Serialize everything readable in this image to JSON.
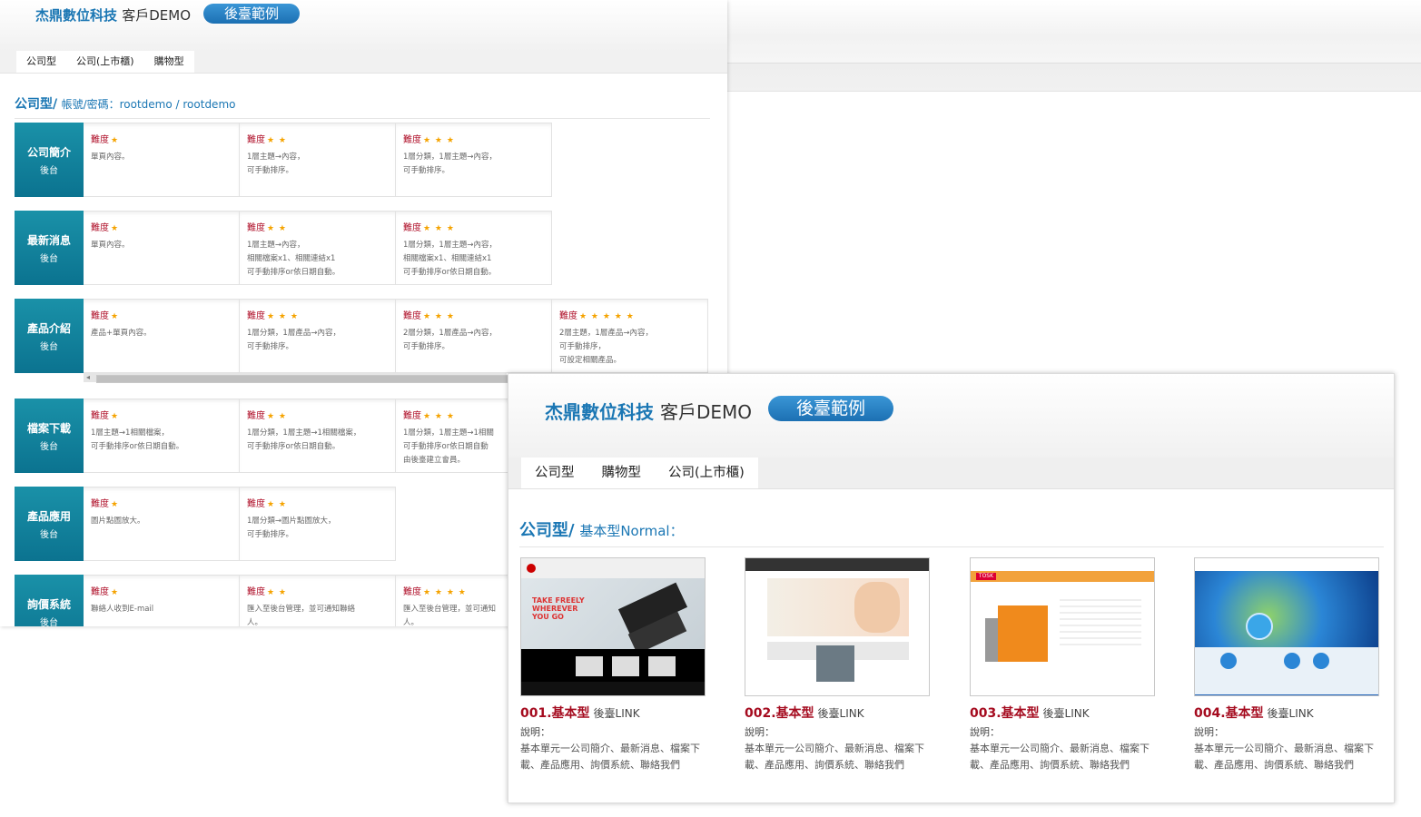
{
  "window1": {
    "brand": "杰鼎數位科技",
    "brand_suffix": "客戶DEMO",
    "badge": "後臺範例",
    "tabs": [
      "公司型",
      "公司(上市櫃)",
      "購物型"
    ],
    "section_title": "公司型/",
    "section_subtitle": "帳號/密碼：rootdemo / rootdemo",
    "difficulty_label": "難度",
    "rows": [
      {
        "name": "公司簡介",
        "sub": "後台",
        "cells": [
          {
            "stars": "★",
            "desc": "單頁內容。"
          },
          {
            "stars": "★ ★",
            "desc": "1層主題→內容，\n可手動排序。"
          },
          {
            "stars": "★ ★ ★",
            "desc": "1層分類，1層主題→內容，\n可手動排序。"
          }
        ]
      },
      {
        "name": "最新消息",
        "sub": "後台",
        "cells": [
          {
            "stars": "★",
            "desc": "單頁內容。"
          },
          {
            "stars": "★ ★",
            "desc": "1層主題→內容，\n相關檔案x1、相關連結x1\n可手動排序or依日期自動。"
          },
          {
            "stars": "★ ★ ★",
            "desc": "1層分類，1層主題→內容，\n相關檔案x1、相關連結x1\n可手動排序or依日期自動。"
          }
        ]
      },
      {
        "name": "產品介紹",
        "sub": "後台",
        "cells": [
          {
            "stars": "★",
            "desc": "產品+單頁內容。"
          },
          {
            "stars": "★ ★ ★",
            "desc": "1層分類，1層產品→內容，\n可手動排序。"
          },
          {
            "stars": "★ ★ ★",
            "desc": "2層分類，1層產品→內容，\n可手動排序。"
          },
          {
            "stars": "★ ★ ★ ★ ★",
            "desc": "2層主題，1層產品→內容，\n可手動排序，\n可設定相關產品。"
          }
        ]
      },
      {
        "name": "檔案下載",
        "sub": "後台",
        "cells": [
          {
            "stars": "★",
            "desc": "1層主題→1相關檔案，\n可手動排序or依日期自動。"
          },
          {
            "stars": "★ ★",
            "desc": "1層分類，1層主題→1相關檔案，\n可手動排序or依日期自動。"
          },
          {
            "stars": "★ ★ ★",
            "desc": "1層分類，1層主題→1相關\n可手動排序or依日期自動\n由後臺建立會員。"
          }
        ]
      },
      {
        "name": "產品應用",
        "sub": "後台",
        "cells": [
          {
            "stars": "★",
            "desc": "圖片點圖放大。"
          },
          {
            "stars": "★ ★",
            "desc": "1層分類→圖片點圖放大，\n可手動排序。"
          }
        ]
      },
      {
        "name": "詢價系統",
        "sub": "後台",
        "cells": [
          {
            "stars": "★",
            "desc": "聯絡人收到E-mail"
          },
          {
            "stars": "★ ★",
            "desc": "匯入至後台管理，並可通知聯絡\n人。"
          },
          {
            "stars": "★ ★ ★ ★",
            "desc": "匯入至後台管理，並可通知\n人。"
          }
        ]
      }
    ]
  },
  "window2": {
    "brand": "杰鼎數位科技",
    "brand_suffix": "客戶DEMO",
    "badge": "後臺範例",
    "tabs": [
      "公司型",
      "購物型",
      "公司(上市櫃)"
    ],
    "section_title": "公司型/",
    "section_subtitle": "基本型Normal：",
    "cards": [
      {
        "title": "001.基本型",
        "link": "後臺LINK",
        "label": "說明：",
        "desc": "基本單元一公司簡介、最新消息、檔案下載、產品應用、詢價系統、聯絡我們",
        "thumb_text": "TAKE FREELY WHEREVER YOU GO"
      },
      {
        "title": "002.基本型",
        "link": "後臺LINK",
        "label": "說明：",
        "desc": "基本單元一公司簡介、最新消息、檔案下載、產品應用、詢價系統、聯絡我們"
      },
      {
        "title": "003.基本型",
        "link": "後臺LINK",
        "label": "說明：",
        "desc": "基本單元一公司簡介、最新消息、檔案下載、產品應用、詢價系統、聯絡我們",
        "thumb_text": "TOSK"
      },
      {
        "title": "004.基本型",
        "link": "後臺LINK",
        "label": "說明：",
        "desc": "基本單元一公司簡介、最新消息、檔案下載、產品應用、詢價系統、聯絡我們"
      }
    ]
  },
  "colors": {
    "brand_blue": "#1b77b4",
    "teal": "#0b7390",
    "difficulty_red": "#b0122b",
    "star": "#f5a300",
    "title_red": "#a50b1f"
  }
}
